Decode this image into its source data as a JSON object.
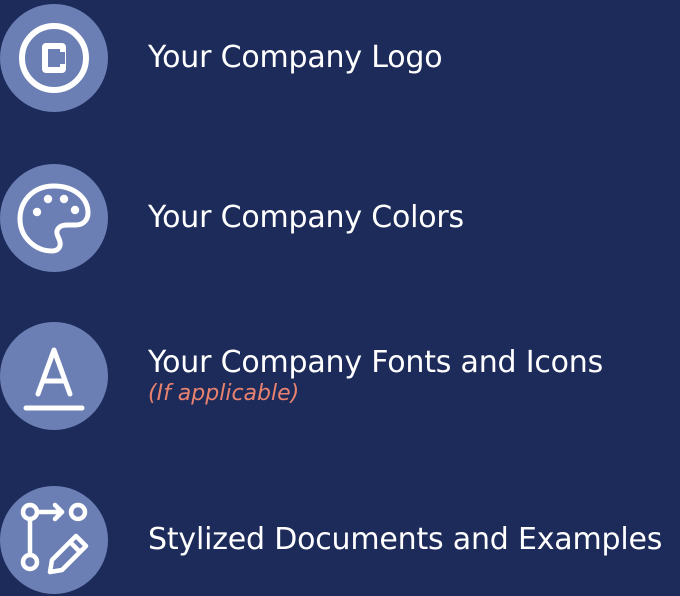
{
  "colors": {
    "background": "#1d2b5a",
    "icon_circle": "#6b7fb5",
    "icon_stroke": "#ffffff",
    "label_text": "#ffffff",
    "note_text": "#e8826f"
  },
  "items": [
    {
      "icon": "copyright-logo-icon",
      "label": "Your Company Logo"
    },
    {
      "icon": "palette-icon",
      "label": "Your Company Colors"
    },
    {
      "icon": "font-letter-icon",
      "label": "Your Company Fonts and Icons",
      "note": "(If applicable)"
    },
    {
      "icon": "document-flow-pencil-icon",
      "label": "Stylized Documents and Examples"
    }
  ]
}
